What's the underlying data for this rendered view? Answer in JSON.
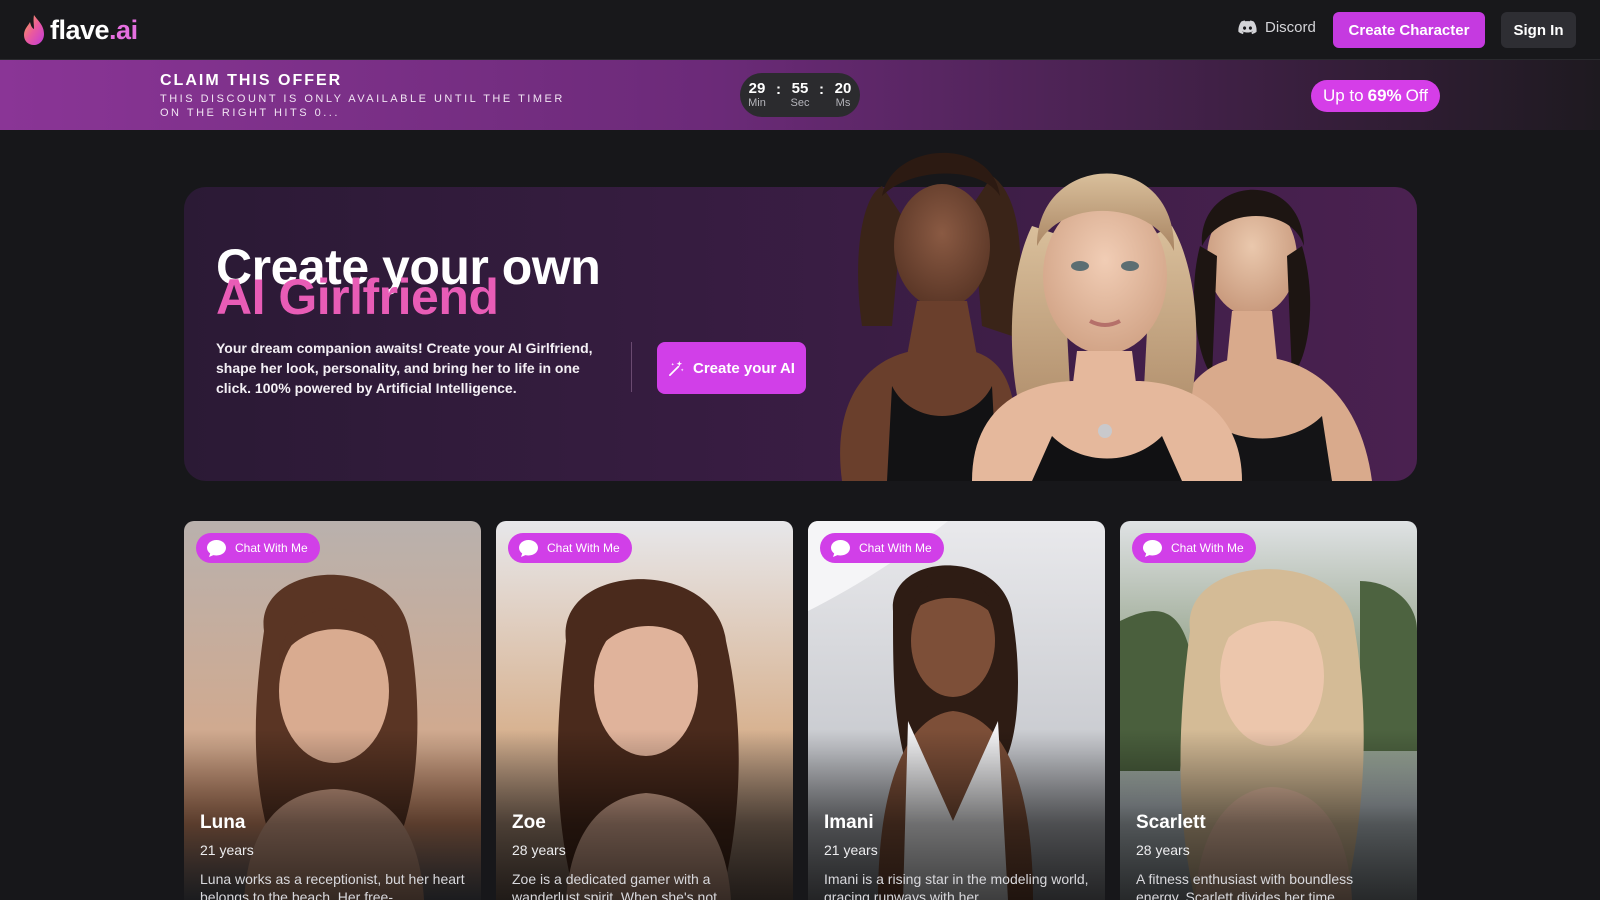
{
  "header": {
    "logo_text_main": "flave",
    "logo_text_suffix": ".ai",
    "discord_label": "Discord",
    "create_character_label": "Create Character",
    "sign_in_label": "Sign In"
  },
  "offer": {
    "title": "CLAIM THIS OFFER",
    "subtitle": "THIS DISCOUNT IS ONLY AVAILABLE UNTIL THE TIMER ON THE RIGHT HITS 0...",
    "timer": {
      "minutes": "29",
      "minutes_label": "Min",
      "seconds": "55",
      "seconds_label": "Sec",
      "ms": "20",
      "ms_label": "Ms"
    },
    "discount_prefix": "Up to",
    "discount_value": "69%",
    "discount_suffix": "Off"
  },
  "hero": {
    "title_line1": "Create your own",
    "title_line2": "AI Girlfriend",
    "description": "Your dream companion awaits! Create your AI Girlfriend, shape her look, personality, and bring her to life in one click. 100% powered by Artificial Intelligence.",
    "cta_label": "Create your AI"
  },
  "cards": [
    {
      "chat_label": "Chat With Me",
      "name": "Luna",
      "age": "21 years",
      "bio": "Luna works as a receptionist, but her heart belongs to the beach. Her free-"
    },
    {
      "chat_label": "Chat With Me",
      "name": "Zoe",
      "age": "28 years",
      "bio": "Zoe is a dedicated gamer with a wanderlust spirit. When she's not"
    },
    {
      "chat_label": "Chat With Me",
      "name": "Imani",
      "age": "21 years",
      "bio": "Imani is a rising star in the modeling world, gracing runways with her"
    },
    {
      "chat_label": "Chat With Me",
      "name": "Scarlett",
      "age": "28 years",
      "bio": "A fitness enthusiast with boundless energy, Scarlett divides her time"
    }
  ],
  "colors": {
    "accent": "#d13fe8",
    "hero_pink": "#e85cb6",
    "background": "#17171a"
  },
  "icons": {
    "discord": "discord-icon",
    "magic": "magic-wand-icon",
    "chat": "chat-bubble-icon"
  }
}
